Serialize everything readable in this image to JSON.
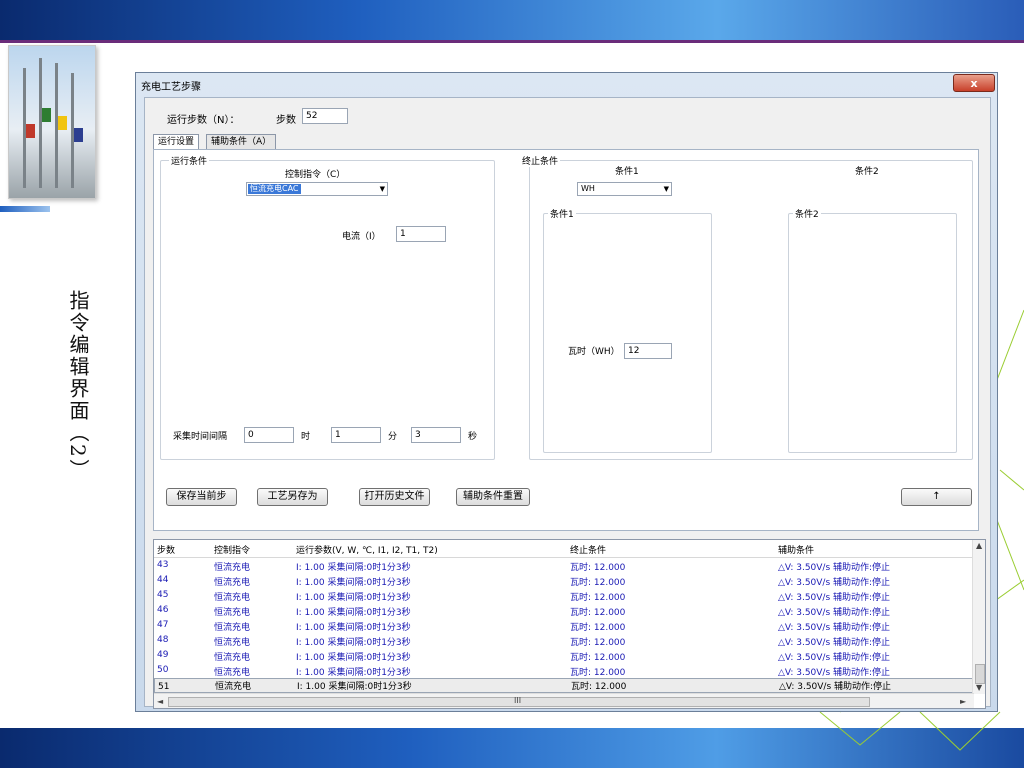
{
  "slide": {
    "vertical_title": "指令编辑界面（2）"
  },
  "window": {
    "title": "充电工艺步骤",
    "close_label": "x"
  },
  "header": {
    "run_steps_label": "运行步数（N）：",
    "step_label": "步数",
    "step_value": "52"
  },
  "tabs": [
    {
      "label": "运行设置",
      "active": true
    },
    {
      "label": "辅助条件（A）",
      "active": false
    }
  ],
  "run_condition": {
    "group_label": "运行条件",
    "control_cmd_label": "控制指令（C）",
    "control_cmd_value": "恒流充电CAC",
    "current_label": "电流（I）",
    "current_value": "1",
    "interval_label": "采集时间间隔",
    "hours_value": "0",
    "hours_unit": "时",
    "minutes_value": "1",
    "minutes_unit": "分",
    "seconds_value": "3",
    "seconds_unit": "秒"
  },
  "stop_condition": {
    "group_label": "终止条件",
    "cond1_label": "条件1",
    "cond1_value": "WH",
    "cond2_label": "条件2",
    "sub1_label": "条件1",
    "sub2_label": "条件2",
    "wh_label": "瓦时（WH）",
    "wh_value": "12"
  },
  "buttons": {
    "save_step": "保存当前步",
    "save_as": "工艺另存为",
    "open_history": "打开历史文件",
    "reset_aux": "辅助条件重置",
    "up_arrow": "↑"
  },
  "table": {
    "columns": [
      "步数",
      "控制指令",
      "运行参数(V, W, ℃, I1, I2, T1, T2)",
      "终止条件",
      "辅助条件"
    ],
    "rows": [
      [
        "43",
        "恒流充电",
        "I: 1.00 采集间隔:0时1分3秒",
        "瓦时: 12.000",
        "△V: 3.50V/s 辅助动作:停止"
      ],
      [
        "44",
        "恒流充电",
        "I: 1.00 采集间隔:0时1分3秒",
        "瓦时: 12.000",
        "△V: 3.50V/s 辅助动作:停止"
      ],
      [
        "45",
        "恒流充电",
        "I: 1.00 采集间隔:0时1分3秒",
        "瓦时: 12.000",
        "△V: 3.50V/s 辅助动作:停止"
      ],
      [
        "46",
        "恒流充电",
        "I: 1.00 采集间隔:0时1分3秒",
        "瓦时: 12.000",
        "△V: 3.50V/s 辅助动作:停止"
      ],
      [
        "47",
        "恒流充电",
        "I: 1.00 采集间隔:0时1分3秒",
        "瓦时: 12.000",
        "△V: 3.50V/s 辅助动作:停止"
      ],
      [
        "48",
        "恒流充电",
        "I: 1.00 采集间隔:0时1分3秒",
        "瓦时: 12.000",
        "△V: 3.50V/s 辅助动作:停止"
      ],
      [
        "49",
        "恒流充电",
        "I: 1.00 采集间隔:0时1分3秒",
        "瓦时: 12.000",
        "△V: 3.50V/s 辅助动作:停止"
      ],
      [
        "50",
        "恒流充电",
        "I: 1.00 采集间隔:0时1分3秒",
        "瓦时: 12.000",
        "△V: 3.50V/s 辅助动作:停止"
      ],
      [
        "51",
        "恒流充电",
        "I: 1.00 采集间隔:0时1分3秒",
        "瓦时: 12.000",
        "△V: 3.50V/s 辅助动作:停止"
      ]
    ],
    "selected_row": "51",
    "scroll_mid_label": "III"
  },
  "colors": {
    "accent_blue": "#1f5fbf",
    "row_text": "#1a1ab4",
    "highlight": "#3a78d8",
    "close_red": "#c8402a"
  }
}
